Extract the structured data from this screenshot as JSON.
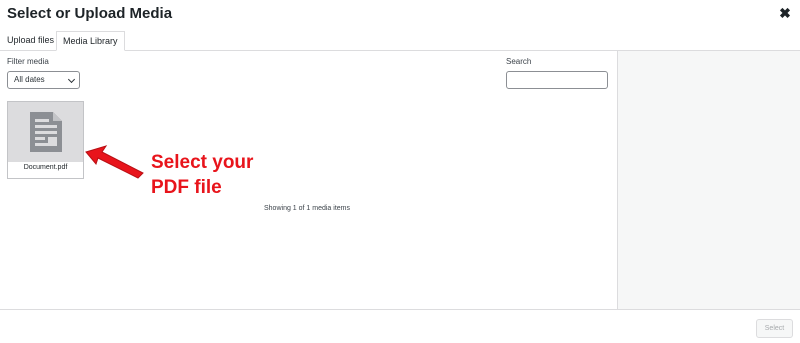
{
  "modal": {
    "title": "Select or Upload Media",
    "close_icon": "close-icon",
    "close_glyph": "✖"
  },
  "tabs": [
    {
      "label": "Upload files",
      "active": false
    },
    {
      "label": "Media Library",
      "active": true
    }
  ],
  "toolbar": {
    "filter_label": "Filter media",
    "date_filter_value": "All dates",
    "search_label": "Search",
    "search_value": "",
    "search_placeholder": ""
  },
  "attachments": [
    {
      "filename": "Document.pdf",
      "icon": "document-icon"
    }
  ],
  "annotation": {
    "line1": "Select your",
    "line2": "PDF file",
    "color": "#e8141b"
  },
  "status": {
    "count_text": "Showing 1 of 1 media items"
  },
  "footer": {
    "select_label": "Select",
    "select_disabled": true
  },
  "colors": {
    "thumb_bg": "#dcdcde",
    "doc_icon": "#8c8f94",
    "sidebar_bg": "#f6f7f7"
  }
}
